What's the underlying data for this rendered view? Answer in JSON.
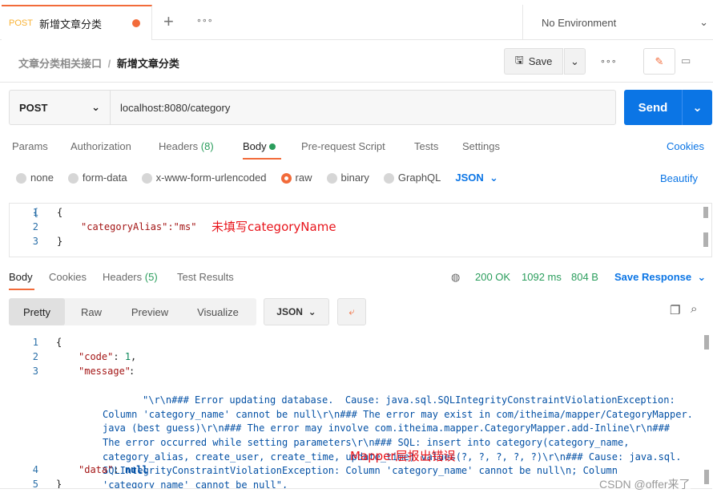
{
  "tab": {
    "method": "POST",
    "title": "新增文章分类",
    "new_icon": "plus-icon",
    "more_icon": "more-icon"
  },
  "environment": "No Environment",
  "breadcrumb": {
    "parent": "文章分类相关接口",
    "sep": "/",
    "current": "新增文章分类"
  },
  "toolbar": {
    "save": "Save",
    "more": "∘∘∘"
  },
  "request": {
    "method": "POST",
    "url": "localhost:8080/category",
    "send": "Send"
  },
  "req_tabs": [
    "Params",
    "Authorization",
    "Headers",
    "Body",
    "Pre-request Script",
    "Tests",
    "Settings"
  ],
  "req_headers_count": "(8)",
  "cookies": "Cookies",
  "body_types": [
    "none",
    "form-data",
    "x-www-form-urlencoded",
    "raw",
    "binary",
    "GraphQL"
  ],
  "body_format": "JSON",
  "beautify": "Beautify",
  "req_body": {
    "lines": [
      "{",
      "\"categoryAlias\":\"ms\"",
      "}"
    ],
    "annotation": "未填写categoryName"
  },
  "resp_tabs": [
    "Body",
    "Cookies",
    "Headers",
    "Test Results"
  ],
  "resp_headers_count": "(5)",
  "status": {
    "code": "200 OK",
    "time": "1092 ms",
    "size": "804 B"
  },
  "save_response": "Save Response",
  "view_modes": [
    "Pretty",
    "Raw",
    "Preview",
    "Visualize"
  ],
  "resp_format": "JSON",
  "response": {
    "code_key": "\"code\"",
    "code_val": "1",
    "message_key": "\"message\"",
    "data_key": "\"data\"",
    "data_val": "null",
    "message_lines": [
      "\"\\r\\n### Error updating database.  Cause: java.sql.SQLIntegrityConstraintViolationException:",
      "Column 'category_name' cannot be null\\r\\n### The error may exist in com/itheima/mapper/CategoryMapper.",
      "java (best guess)\\r\\n### The error may involve com.itheima.mapper.CategoryMapper.add-Inline\\r\\n###",
      "The error occurred while setting parameters\\r\\n### SQL: insert into category(category_name,",
      "category_alias, create_user, create_time, update_time) values(?, ?, ?, ?, ?)\\r\\n### Cause: java.sql.",
      "SQLIntegrityConstraintViolationException: Column 'category_name' cannot be null\\n; Column",
      "'category_name' cannot be null\","
    ],
    "annotation": "Mapper层报出错误"
  },
  "watermark": "CSDN @offer来了"
}
